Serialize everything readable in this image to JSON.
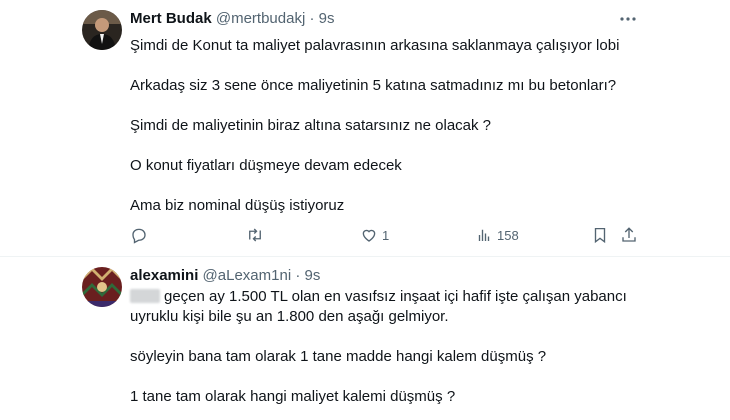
{
  "tweets": [
    {
      "author_name": "Mert Budak",
      "author_handle": "@mertbudakj",
      "separator": "·",
      "time": "9s",
      "lines": [
        "Şimdi de Konut ta maliyet palavrasının arkasına saklanmaya çalışıyor lobi",
        "Arkadaş siz 3 sene önce maliyetinin 5 katına satmadınız mı bu betonları?",
        "Şimdi de maliyetinin biraz altına satarsınız ne olacak ?",
        "O konut fiyatları düşmeye devam edecek",
        "Ama biz nominal düşüş istiyoruz"
      ],
      "actions": {
        "reply_icon": "reply-icon",
        "retweet_icon": "retweet-icon",
        "like_icon": "heart-icon",
        "like_count": "1",
        "views_icon": "views-icon",
        "views_count": "158",
        "bookmark_icon": "bookmark-icon",
        "share_icon": "share-icon"
      }
    },
    {
      "author_name": "alexamini",
      "author_handle": "@aLexam1ni",
      "separator": "·",
      "time": "9s",
      "lines": [
        "geçen ay 1.500 TL olan en vasıfsız inşaat içi hafif işte çalışan yabancı",
        "uyruklu kişi bile şu an 1.800 den aşağı gelmiyor.",
        "söyleyin bana tam olarak 1 tane madde hangi kalem düşmüş ?",
        "1 tane tam olarak hangi maliyet kalemi düşmüş ?"
      ]
    }
  ],
  "colors": {
    "text": "#0f1419",
    "secondary": "#536471",
    "divider": "#eff3f4"
  }
}
